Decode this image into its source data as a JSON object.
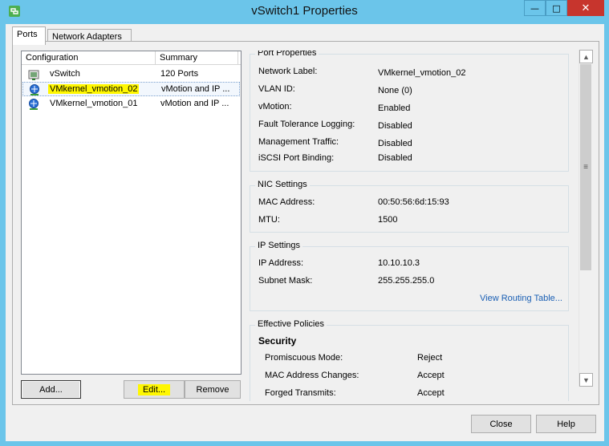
{
  "window": {
    "title": "vSwitch1 Properties",
    "minimize_glyph": "—",
    "maximize_glyph": "□",
    "close_glyph": "✕"
  },
  "tabs": [
    {
      "label": "Ports",
      "active": true
    },
    {
      "label": "Network Adapters",
      "active": false
    }
  ],
  "list": {
    "columns": [
      "Configuration",
      "Summary"
    ],
    "rows": [
      {
        "icon": "vswitch-icon",
        "name": "vSwitch",
        "summary": "120 Ports",
        "selected": false
      },
      {
        "icon": "vmkernel-port-icon",
        "name": "VMkernel_vmotion_02",
        "summary": "vMotion and IP ...",
        "selected": true
      },
      {
        "icon": "vmkernel-port-icon",
        "name": "VMkernel_vmotion_01",
        "summary": "vMotion and IP ...",
        "selected": false
      }
    ]
  },
  "buttons": {
    "add": "Add...",
    "edit": "Edit...",
    "remove": "Remove",
    "close": "Close",
    "help": "Help"
  },
  "port_properties": {
    "title": "Port Properties",
    "items": [
      {
        "label": "Network Label:",
        "value": "VMkernel_vmotion_02"
      },
      {
        "label": "VLAN ID:",
        "value": "None (0)"
      },
      {
        "label": "vMotion:",
        "value": "Enabled"
      },
      {
        "label": "Fault Tolerance Logging:",
        "value": "Disabled"
      },
      {
        "label": "Management Traffic:",
        "value": "Disabled"
      },
      {
        "label": "iSCSI Port Binding:",
        "value": "Disabled"
      }
    ]
  },
  "nic_settings": {
    "title": "NIC Settings",
    "items": [
      {
        "label": "MAC Address:",
        "value": "00:50:56:6d:15:93"
      },
      {
        "label": "MTU:",
        "value": "1500"
      }
    ]
  },
  "ip_settings": {
    "title": "IP Settings",
    "items": [
      {
        "label": "IP Address:",
        "value": "10.10.10.3"
      },
      {
        "label": "Subnet Mask:",
        "value": "255.255.255.0"
      }
    ],
    "link": "View Routing Table..."
  },
  "effective_policies": {
    "title": "Effective Policies",
    "section": "Security",
    "items": [
      {
        "label": "Promiscuous Mode:",
        "value": "Reject"
      },
      {
        "label": "MAC Address Changes:",
        "value": "Accept"
      },
      {
        "label": "Forged Transmits:",
        "value": "Accept"
      }
    ]
  },
  "colors": {
    "title_bar": "#6bc5ea",
    "highlight": "#fff700",
    "link": "#1a5fb4"
  }
}
